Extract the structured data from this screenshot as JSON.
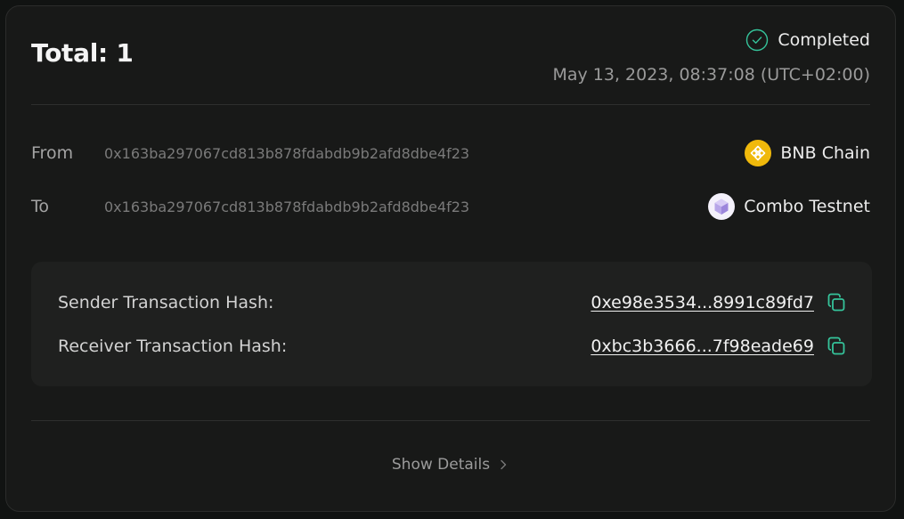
{
  "summary": {
    "title": "Total: 1",
    "status": "Completed",
    "timestamp": "May 13, 2023, 08:37:08 (UTC+02:00)"
  },
  "route": {
    "from": {
      "label": "From",
      "address": "0x163ba297067cd813b878fdabdb9b2afd8dbe4f23",
      "chain": "BNB Chain",
      "chain_icon": "bnb-chain-icon"
    },
    "to": {
      "label": "To",
      "address": "0x163ba297067cd813b878fdabdb9b2afd8dbe4f23",
      "chain": "Combo Testnet",
      "chain_icon": "combo-testnet-icon"
    }
  },
  "hashes": {
    "sender": {
      "label": "Sender Transaction Hash:",
      "value": "0xe98e3534...8991c89fd7"
    },
    "receiver": {
      "label": "Receiver Transaction Hash:",
      "value": "0xbc3b3666...7f98eade69"
    }
  },
  "footer": {
    "show_details": "Show Details"
  },
  "colors": {
    "background": "#181918",
    "accent": "#35c49b",
    "bnb_yellow": "#f0b90b",
    "text_primary": "#ececec",
    "text_muted": "#9a9a9a"
  }
}
